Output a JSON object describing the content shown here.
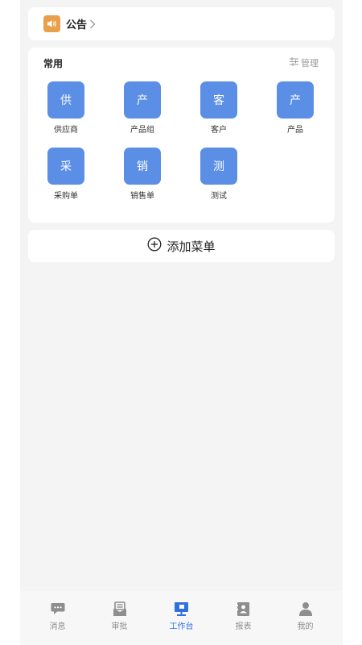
{
  "notice": {
    "title": "公告",
    "icon": "speaker-icon"
  },
  "common": {
    "title": "常用",
    "manage_label": "管理",
    "items": [
      {
        "glyph": "供",
        "label": "供应商"
      },
      {
        "glyph": "产",
        "label": "产品组"
      },
      {
        "glyph": "客",
        "label": "客户"
      },
      {
        "glyph": "产",
        "label": "产品"
      },
      {
        "glyph": "采",
        "label": "采购单"
      },
      {
        "glyph": "销",
        "label": "销售单"
      },
      {
        "glyph": "测",
        "label": "测试"
      }
    ]
  },
  "add_menu": {
    "label": "添加菜单"
  },
  "tabbar": {
    "tabs": [
      {
        "label": "消息",
        "icon": "chat-bubble-icon",
        "active": false
      },
      {
        "label": "审批",
        "icon": "approval-icon",
        "active": false
      },
      {
        "label": "工作台",
        "icon": "workbench-icon",
        "active": true
      },
      {
        "label": "报表",
        "icon": "report-icon",
        "active": false
      },
      {
        "label": "我的",
        "icon": "user-icon",
        "active": false
      }
    ]
  },
  "colors": {
    "tile": "#5b8fe6",
    "notice_icon": "#e8a04a",
    "tab_active": "#2f6fe0",
    "tab_inactive": "#8e8e8e"
  }
}
